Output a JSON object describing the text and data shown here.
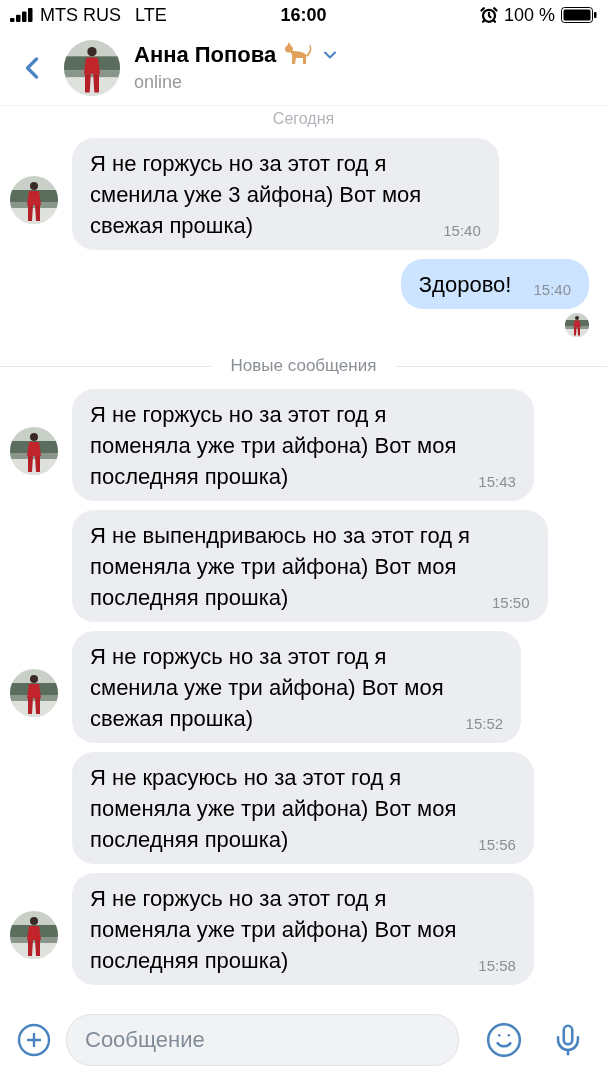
{
  "status_bar": {
    "carrier": "MTS RUS",
    "network": "LTE",
    "time": "16:00",
    "battery": "100 %"
  },
  "header": {
    "name": "Анна Попова",
    "status": "online"
  },
  "date_badge": "Сегодня",
  "messages": [
    {
      "kind": "incoming",
      "text": "Я не горжусь но за этот год я\nсменила уже 3 айфона) Вот моя\nсвежая прошка)",
      "time": "15:40",
      "avatar": true
    },
    {
      "kind": "outgoing",
      "text": "Здорово!",
      "time": "15:40",
      "avatar": true
    },
    {
      "kind": "divider",
      "text": "Новые сообщения"
    },
    {
      "kind": "incoming",
      "text": "Я не горжусь но за этот год я\nпоменяла уже три айфона) Вот моя\nпоследняя прошка)",
      "time": "15:43",
      "avatar": true
    },
    {
      "kind": "incoming",
      "text": "Я не выпендриваюсь но за этот год я\nпоменяла уже три айфона) Вот моя\nпоследняя прошка)",
      "time": "15:50",
      "avatar": false
    },
    {
      "kind": "incoming",
      "text": "Я не горжусь но за этот год я\nсменила уже три айфона) Вот моя\nсвежая прошка)",
      "time": "15:52",
      "avatar": true
    },
    {
      "kind": "incoming",
      "text": "Я не красуюсь но за этот год я\nпоменяла уже три айфона) Вот моя\nпоследняя прошка)",
      "time": "15:56",
      "avatar": false
    },
    {
      "kind": "incoming",
      "text": "Я не горжусь но за этот год я\nпоменяла уже три айфона) Вот моя\nпоследняя прошка)",
      "time": "15:58",
      "avatar": true
    }
  ],
  "composer": {
    "placeholder": "Сообщение"
  }
}
